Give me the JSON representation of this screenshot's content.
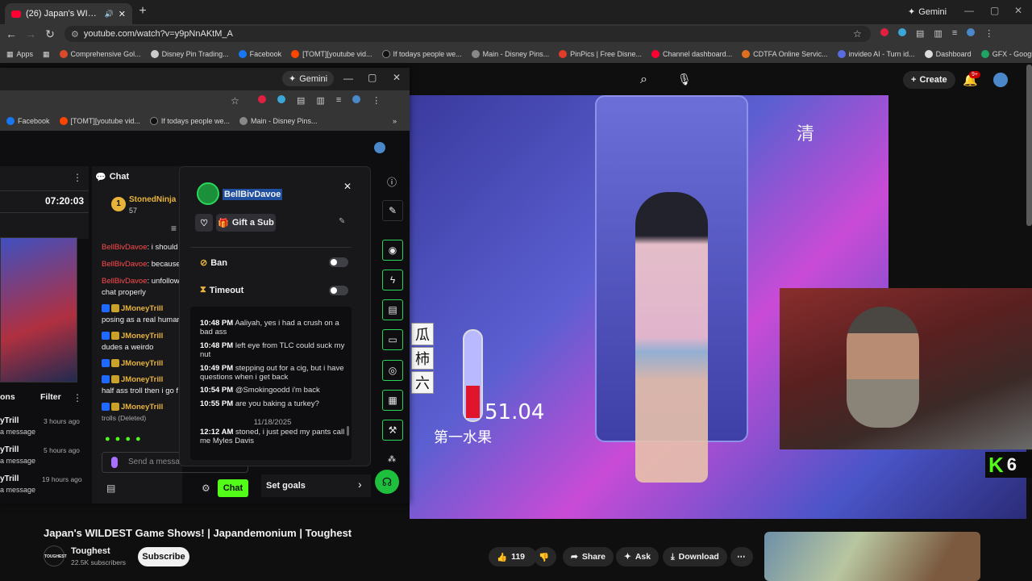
{
  "browser": {
    "tab_title": "(26) Japan's WILDEST Game",
    "gemini_label": "Gemini",
    "url": "youtube.com/watch?v=y9pNnAKtM_A",
    "bookmarks": [
      "Apps",
      "Comprehensive Gol...",
      "Disney Pin Trading...",
      "Facebook",
      "[TOMT][youtube vid...",
      "If todays people we...",
      "Main - Disney Pins...",
      "PinPics | Free Disne...",
      "Channel dashboard...",
      "CDTFA Online Servic...",
      "invideo AI - Turn id...",
      "Dashboard",
      "GFX - Google Drive"
    ]
  },
  "youtube": {
    "create_label": "Create",
    "notif_count": "9+",
    "video_title": "Japan's WILDEST Game Shows! | Japandemonium | Toughest",
    "channel_logo_text": "TOUGHEST",
    "channel": "Toughest",
    "subscribers": "22.5K subscribers",
    "subscribe_label": "Subscribe",
    "likes": "119",
    "share_label": "Share",
    "ask_label": "Ask",
    "download_label": "Download",
    "video_overlay": {
      "kanji": [
        "瓜",
        "柿",
        "六"
      ],
      "score": "51.04",
      "banner": "第一水果",
      "corner_text": "清",
      "kick_badge": "6"
    }
  },
  "popup": {
    "gemini_label": "Gemini",
    "bookmarks": [
      "Facebook",
      "[TOMT][youtube vid...",
      "If todays people we...",
      "Main - Disney Pins..."
    ],
    "timer": "07:20:03",
    "chat_header": "Chat",
    "leaderboard": {
      "rank": "1",
      "name": "StonedNinja",
      "points": "57"
    },
    "chat_lines": [
      {
        "user": "BellBivDavoe",
        "text": ": i should"
      },
      {
        "user": "BellBivDavoe",
        "text": ": because"
      },
      {
        "user": "BellBivDavoe",
        "text": ": unfollow"
      },
      {
        "user": "",
        "text": "chat properly"
      },
      {
        "user": "JMoneyTrill",
        "text": ""
      },
      {
        "user": "",
        "text": "posing as a real human"
      },
      {
        "user": "JMoneyTrill",
        "text": ""
      },
      {
        "user": "",
        "text": "dudes a weirdo"
      },
      {
        "user": "JMoneyTrill",
        "text": ""
      },
      {
        "user": "JMoneyTrill",
        "text": ""
      },
      {
        "user": "",
        "text": "half ass troll then i go f"
      },
      {
        "user": "JMoneyTrill",
        "text": ""
      },
      {
        "user": "",
        "text": "trolls (Deleted)"
      }
    ],
    "left_list_header": "ons",
    "filter_label": "Filter",
    "left_list": [
      {
        "name": "yTrill",
        "time": "3 hours ago",
        "sub": "a message"
      },
      {
        "name": "yTrill",
        "time": "5 hours ago",
        "sub": "a message"
      },
      {
        "name": "yTrill",
        "time": "19 hours ago",
        "sub": "a message"
      }
    ],
    "send_placeholder": "Send a messa",
    "chat_button": "Chat",
    "set_goals": "Set goals",
    "card": {
      "username": "BellBivDavoe",
      "gift_sub": "Gift a Sub",
      "ban_label": "Ban",
      "timeout_label": "Timeout",
      "messages": [
        {
          "time": "10:48 PM",
          "text": "Aaliyah, yes i had a crush on a bad ass"
        },
        {
          "time": "10:48 PM",
          "text": "left eye from TLC could suck my nut"
        },
        {
          "time": "10:49 PM",
          "text": "stepping out for a cig, but i have questions when i get back"
        },
        {
          "time": "10:54 PM",
          "text": "@Smokingoodd i'm back"
        },
        {
          "time": "10:55 PM",
          "text": "are you baking a turkey?"
        },
        {
          "time": "12:12 AM",
          "text": "stoned, i just peed my pants call me Myles Davis"
        }
      ],
      "date_divider": "11/18/2025"
    }
  }
}
